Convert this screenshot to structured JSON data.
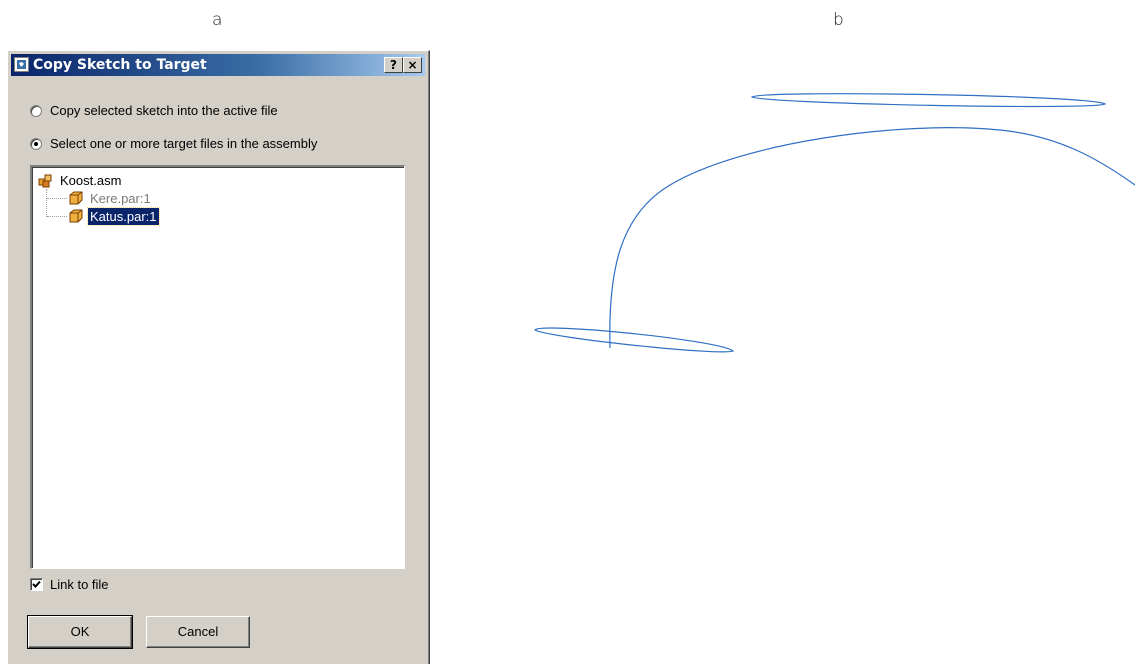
{
  "panel_labels": {
    "left": "a",
    "right": "b"
  },
  "dialog": {
    "title": "Copy Sketch to Target",
    "help_button": "?",
    "close_button": "×",
    "options": [
      {
        "label": "Copy selected sketch into the active file",
        "selected": false
      },
      {
        "label": "Select one or more target files in the assembly",
        "selected": true
      }
    ],
    "tree": {
      "root": {
        "label": "Koost.asm",
        "icon": "assembly-icon"
      },
      "children": [
        {
          "label": "Kere.par:1",
          "icon": "part-icon",
          "state": "disabled"
        },
        {
          "label": "Katus.par:1",
          "icon": "part-icon",
          "state": "selected"
        }
      ]
    },
    "link_to_file": {
      "label": "Link to file",
      "checked": true
    },
    "ok_label": "OK",
    "cancel_label": "Cancel"
  },
  "colors": {
    "dialog_face": "#d4d0c8",
    "titlebar_start": "#0a246a",
    "titlebar_end": "#a6caf0",
    "selection": "#0a246a",
    "sketch_stroke": "#2f6fc4"
  }
}
